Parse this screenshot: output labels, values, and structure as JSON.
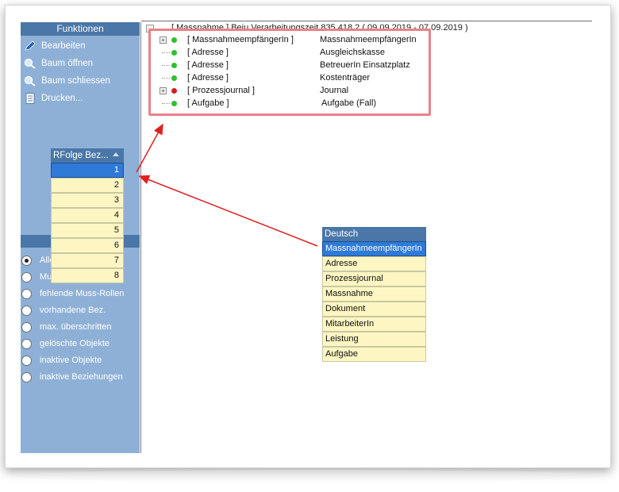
{
  "left_panel": {
    "header": "Funktionen",
    "menu": [
      {
        "label": "Bearbeiten",
        "icon": "pencil-icon"
      },
      {
        "label": "Baum öffnen",
        "icon": "zoom-in-icon"
      },
      {
        "label": "Baum schliessen",
        "icon": "zoom-out-icon"
      },
      {
        "label": "Drucken...",
        "icon": "document-icon"
      }
    ],
    "filters": [
      {
        "label": "Alle",
        "selected": true
      },
      {
        "label": "Mu",
        "selected": false
      },
      {
        "label": "fehlende Muss-Rollen",
        "selected": false
      },
      {
        "label": "vorhandene Bez.",
        "selected": false
      },
      {
        "label": "max. überschritten",
        "selected": false
      },
      {
        "label": "gelöschte Objekte",
        "selected": false
      },
      {
        "label": "inaktive Objekte",
        "selected": false
      },
      {
        "label": "inaktive Beziehungen",
        "selected": false
      }
    ]
  },
  "tree": {
    "root": "[ Massnahme ]   Beju  Verarbeitungszeit 835.418.2 ( 09.09.2019 - 07.09.2019 )",
    "rows": [
      {
        "role": "[ MassnahmeempfängerIn ]",
        "value": "MassnahmeempfängerIn",
        "status": "green",
        "expandable": true
      },
      {
        "role": "[ Adresse ]",
        "value": "Ausgleichskasse",
        "status": "green",
        "expandable": false
      },
      {
        "role": "[ Adresse ]",
        "value": "BetreuerIn Einsatzplatz",
        "status": "green",
        "expandable": false
      },
      {
        "role": "[ Adresse ]",
        "value": "Kostenträger",
        "status": "green",
        "expandable": false
      },
      {
        "role": "[ Prozessjournal ]",
        "value": "Journal",
        "status": "red",
        "expandable": true
      },
      {
        "role": "[ Aufgabe ]",
        "value": "Aufgabe (Fall)",
        "status": "green",
        "expandable": false
      }
    ]
  },
  "order_list": {
    "header": "RFolge Bez...",
    "items": [
      "1",
      "2",
      "3",
      "4",
      "5",
      "6",
      "7",
      "8"
    ],
    "selected_index": 0
  },
  "language_list": {
    "header": "Deutsch",
    "items": [
      "MassnahmeempfängerIn",
      "Adresse",
      "Prozessjournal",
      "Massnahme",
      "Dokument",
      "MitarbeiterIn",
      "Leistung",
      "Aufgabe"
    ],
    "selected_index": 0
  },
  "colors": {
    "panel_bg": "#8fb0d6",
    "header_bg": "#4a76a8",
    "list_bg": "#fdf6c3",
    "selection": "#2f7ad7",
    "highlight_border": "#e8828a",
    "status_green": "#2ec02e",
    "status_red": "#d42020",
    "arrow_red": "#e02020"
  }
}
